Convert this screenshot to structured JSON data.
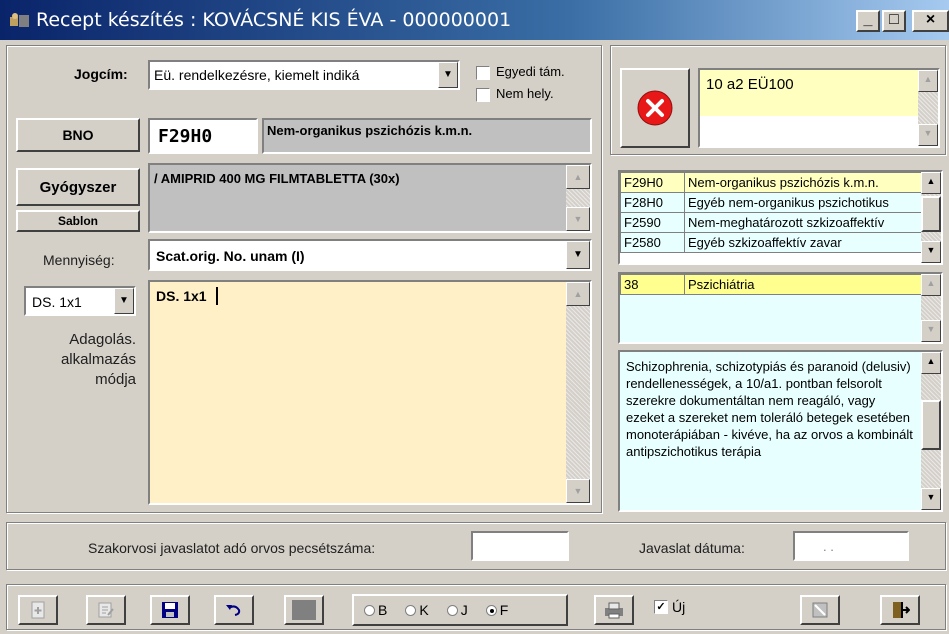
{
  "window": {
    "title": "Recept készítés : KOVÁCSNÉ KIS ÉVA - 000000001",
    "controls": [
      "_",
      "□",
      "×"
    ]
  },
  "form": {
    "jogcim_label": "Jogcím:",
    "jogcim_value": "Eü. rendelkezésre, kiemelt indiká",
    "egyedi_tam": "Egyedi tám.",
    "nem_hely": "Nem hely.",
    "bno_button": "BNO",
    "bno_code": "F29H0",
    "bno_desc": "Nem-organikus pszichózis k.m.n.",
    "gyogyszer_button": "Gyógyszer",
    "sablon_button": "Sablon",
    "gyogyszer_value": "/ AMIPRID 400 MG FILMTABLETTA (30x)",
    "mennyiseg_label": "Mennyiség:",
    "mennyiseg_value": "Scat.orig. No. unam (I)",
    "ds_select": "DS. 1x1",
    "adagolas_label": [
      "Adagolás.",
      "alkalmazás",
      "módja"
    ],
    "adagolas_text": "DS. 1x1"
  },
  "right": {
    "code_box": "10 a2 EÜ100",
    "bno_list": [
      {
        "code": "F29H0",
        "desc": "Nem-organikus pszichózis k.m.n."
      },
      {
        "code": "F28H0",
        "desc": "Egyéb nem-organikus pszichotikus"
      },
      {
        "code": "F2590",
        "desc": "Nem-meghatározott szkizoaffektív"
      },
      {
        "code": "F2580",
        "desc": "Egyéb szkizoaffektív zavar"
      }
    ],
    "szak_list": [
      {
        "code": "38",
        "desc": "Pszichiátria"
      }
    ],
    "indication_text": "Schizophrenia, schizotypiás és paranoid (delusiv) rendellenességek, a 10/a1. pontban felsorolt szerekre dokumentáltan nem reagáló, vagy ezeket a szereket nem toleráló betegek esetében monoterápiában - kivéve, ha az orvos a kombinált antipszichotikus terápia"
  },
  "bottom": {
    "pecset_label": "Szakorvosi javaslatot adó orvos pecsétszáma:",
    "pecset_value": "",
    "datum_label": "Javaslat dátuma:",
    "datum_value": ". ."
  },
  "toolbar": {
    "radios": [
      {
        "label": "B",
        "checked": false
      },
      {
        "label": "K",
        "checked": false
      },
      {
        "label": "J",
        "checked": false
      },
      {
        "label": "F",
        "checked": true
      }
    ],
    "uj_label": "Új",
    "uj_checked": true
  },
  "colors": {
    "title_start": "#0a246a",
    "title_end": "#a6caf0",
    "field_gray": "#c0c0c0",
    "yellow": "#ffffc0",
    "peach": "#fff0c8",
    "cyan": "#e8ffff",
    "cancel_red": "#e81818"
  }
}
